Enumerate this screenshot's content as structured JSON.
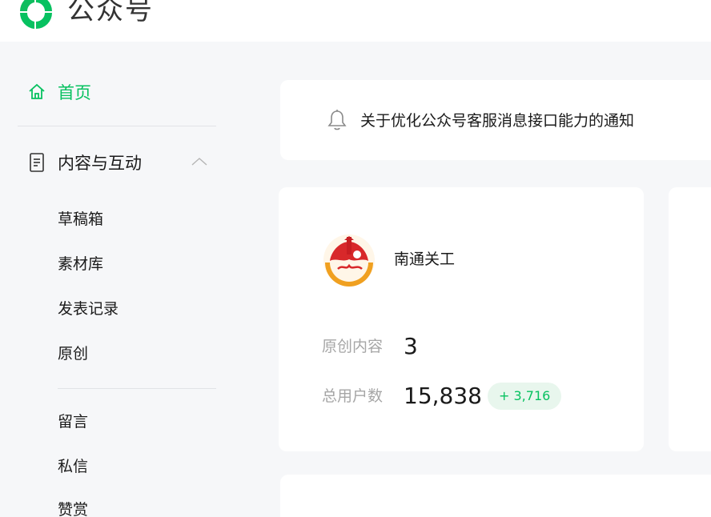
{
  "header": {
    "brand": "公众号",
    "logo_icon": "wechat-official-logo",
    "brand_color": "#07c160"
  },
  "sidebar": {
    "home": {
      "label": "首页",
      "icon": "home-icon"
    },
    "group": {
      "label": "内容与互动",
      "icon": "document-icon",
      "expanded": true
    },
    "items": [
      {
        "label": "草稿箱"
      },
      {
        "label": "素材库"
      },
      {
        "label": "发表记录"
      },
      {
        "label": "原创"
      },
      {
        "label": "留言"
      },
      {
        "label": "私信"
      },
      {
        "label": "赞赏"
      }
    ]
  },
  "notice": {
    "icon": "bell-icon",
    "text": "关于优化公众号客服消息接口能力的通知"
  },
  "account": {
    "name": "南通关工",
    "stats": [
      {
        "label": "原创内容",
        "value": "3"
      },
      {
        "label": "总用户数",
        "value": "15,838",
        "delta": "+ 3,716"
      }
    ]
  }
}
